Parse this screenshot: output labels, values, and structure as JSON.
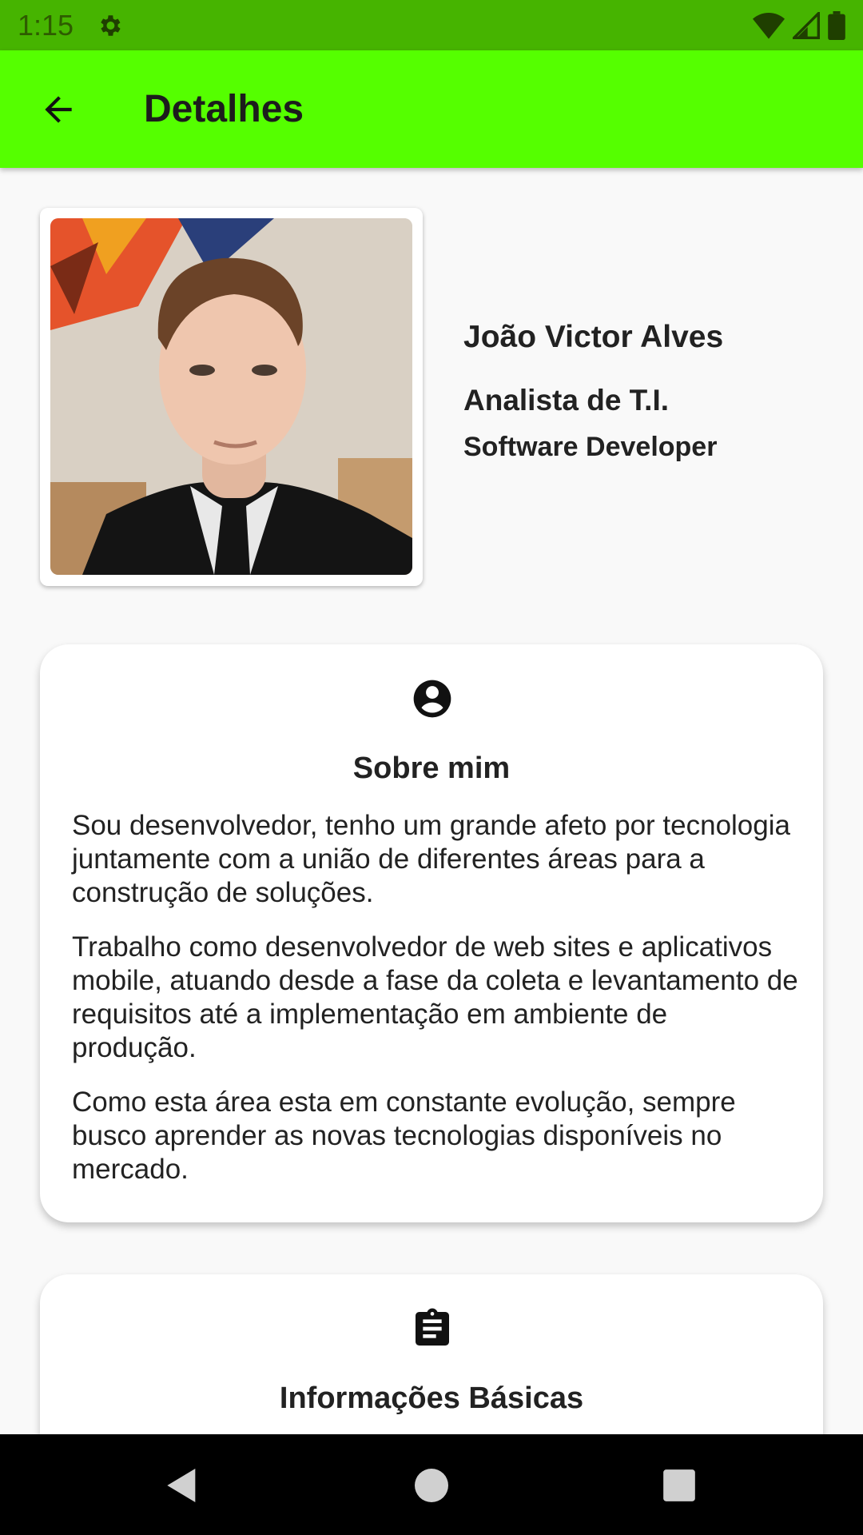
{
  "status_bar": {
    "time": "1:15",
    "icons": [
      "settings-gear-icon",
      "wifi-icon",
      "signal-icon",
      "battery-icon"
    ]
  },
  "app_bar": {
    "title": "Detalhes",
    "back_icon": "arrow-back-icon",
    "color": "#55ff00"
  },
  "profile": {
    "photo": "profile-photo",
    "name": "João Victor Alves",
    "role": "Analista de T.I.",
    "subrole": "Software Developer"
  },
  "about": {
    "icon": "account-circle-icon",
    "title": "Sobre mim",
    "paragraphs": [
      "Sou desenvolvedor, tenho um grande afeto por tecnologia juntamente com a união de diferentes áreas para a construção de soluções.",
      "Trabalho como desenvolvedor de web sites e aplicativos mobile, atuando desde a fase da coleta e levantamento de requisitos até a implementação em ambiente de produção.",
      "Como esta área esta em constante evolução, sempre busco aprender as novas tecnologias disponíveis no mercado."
    ]
  },
  "basic_info": {
    "icon": "clipboard-icon",
    "title": "Informações Básicas"
  },
  "nav_bar": {
    "icons": [
      "nav-back-icon",
      "nav-home-icon",
      "nav-recents-icon"
    ]
  }
}
